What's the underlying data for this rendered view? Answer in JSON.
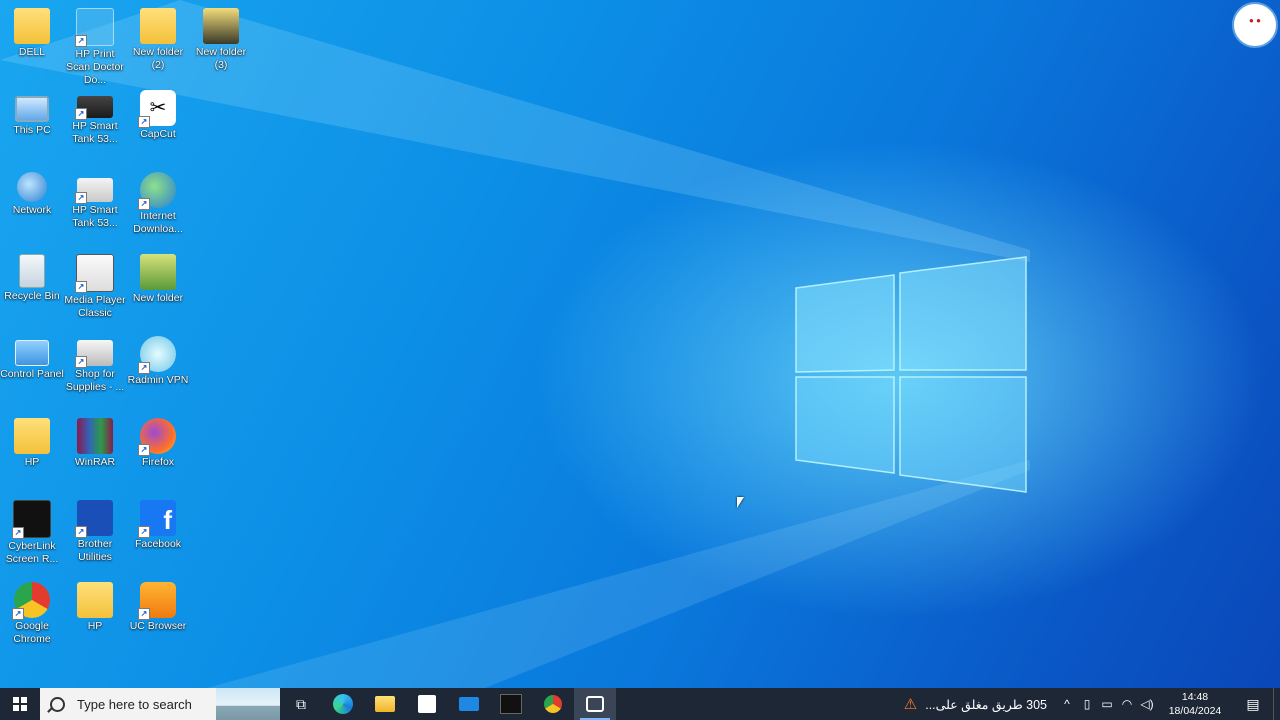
{
  "desktop": {
    "icons": [
      {
        "label": "DELL"
      },
      {
        "label": "HP Print Scan Doctor Do..."
      },
      {
        "label": "New folder (2)"
      },
      {
        "label": "New folder (3)"
      },
      {
        "label": "This PC"
      },
      {
        "label": "HP Smart Tank 53..."
      },
      {
        "label": "CapCut"
      },
      {
        "label": "Network"
      },
      {
        "label": "HP Smart Tank 53..."
      },
      {
        "label": "Internet Downloa..."
      },
      {
        "label": "Recycle Bin"
      },
      {
        "label": "Media Player Classic"
      },
      {
        "label": "New folder"
      },
      {
        "label": "Control Panel"
      },
      {
        "label": "Shop for Supplies - ..."
      },
      {
        "label": "Radmin VPN"
      },
      {
        "label": "HP"
      },
      {
        "label": "WinRAR"
      },
      {
        "label": "Firefox"
      },
      {
        "label": "CyberLink Screen R..."
      },
      {
        "label": "Brother Utilities"
      },
      {
        "label": "Facebook"
      },
      {
        "label": "Google Chrome"
      },
      {
        "label": "HP"
      },
      {
        "label": "UC Browser"
      }
    ]
  },
  "taskbar": {
    "search_placeholder": "Type here to search",
    "news_text": "305 طريق مغلق على...",
    "clock_time": "14:48",
    "clock_date": "18/04/2024"
  }
}
